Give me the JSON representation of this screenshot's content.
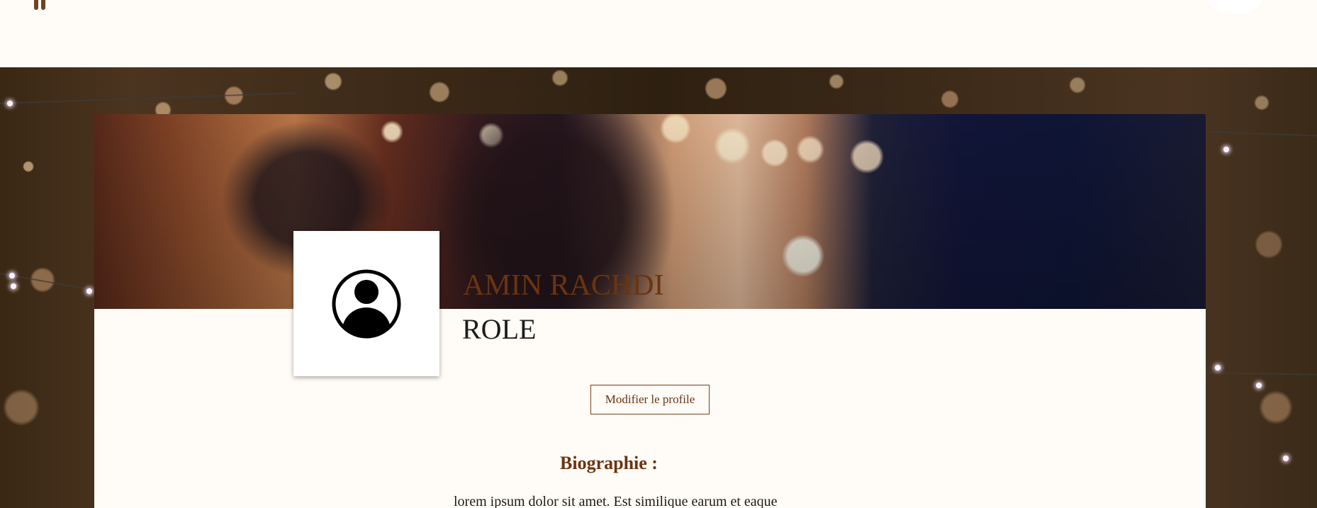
{
  "header": {
    "menu_icon": "menu-icon",
    "user_avatar_icon": "user-avatar"
  },
  "profile": {
    "name": "AMIN RACHDI",
    "role": "ROLE",
    "avatar_icon": "user-circle-icon",
    "edit_button_label": "Modifier le profile"
  },
  "biography": {
    "title": "Biographie :",
    "text": "lorem ipsum dolor sit amet. Est similique earum et eaque"
  },
  "colors": {
    "accent": "#6b3410",
    "page_background": "#fffbf6",
    "text": "#1c1c1c"
  }
}
